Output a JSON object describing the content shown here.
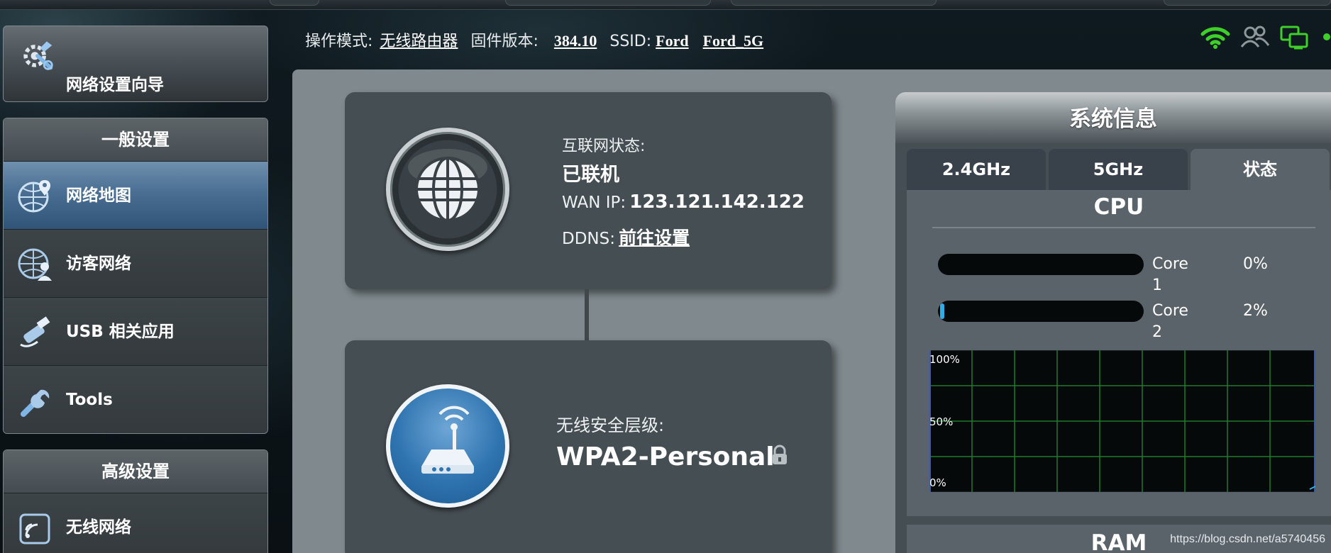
{
  "sidebar": {
    "wizard_label": "网络设置向导",
    "general": {
      "header": "一般设置",
      "items": [
        {
          "label": "网络地图",
          "icon": "network-map-icon",
          "active": true
        },
        {
          "label": "访客网络",
          "icon": "guest-network-icon"
        },
        {
          "label": "USB 相关应用",
          "icon": "usb-icon"
        },
        {
          "label": "Tools",
          "icon": "wrench-icon"
        }
      ]
    },
    "advanced": {
      "header": "高级设置",
      "items": [
        {
          "label": "无线网络",
          "icon": "wireless-icon"
        }
      ]
    }
  },
  "infobar": {
    "mode_label": "操作模式:",
    "mode_value": "无线路由器",
    "firmware_label": "固件版本:",
    "firmware_value": "384.10",
    "ssid_label": "SSID:",
    "ssid_1": "Ford",
    "ssid_2": "Ford_5G",
    "status_icons": [
      "wifi-status-icon",
      "clients-icon",
      "network-monitor-icon"
    ]
  },
  "internet_card": {
    "status_label": "互联网状态:",
    "status_value": "已联机",
    "wan_ip_label": "WAN IP:",
    "wan_ip_value": "123.121.142.122",
    "ddns_label": "DDNS:",
    "ddns_value": "前往设置"
  },
  "security_card": {
    "level_label": "无线安全层级:",
    "level_value": "WPA2-Personal"
  },
  "system_info": {
    "title": "系统信息",
    "tabs": [
      {
        "label": "2.4GHz"
      },
      {
        "label": "5GHz"
      },
      {
        "label": "状态",
        "active": true
      }
    ],
    "cpu_title": "CPU",
    "cores": [
      {
        "name": "Core 1",
        "percent_label": "0%",
        "percent": 0
      },
      {
        "name": "Core 2",
        "percent_label": "2%",
        "percent": 2
      }
    ],
    "graph_labels": [
      "100%",
      "50%",
      "0%"
    ],
    "ram_title": "RAM"
  },
  "colors": {
    "active_nav": "#4a6f93",
    "cpu_fill": "#2eaee8",
    "status_green": "#3fcf2a",
    "graph_grid": "#1f7a2a"
  },
  "watermark": "https://blog.csdn.net/a5740456"
}
